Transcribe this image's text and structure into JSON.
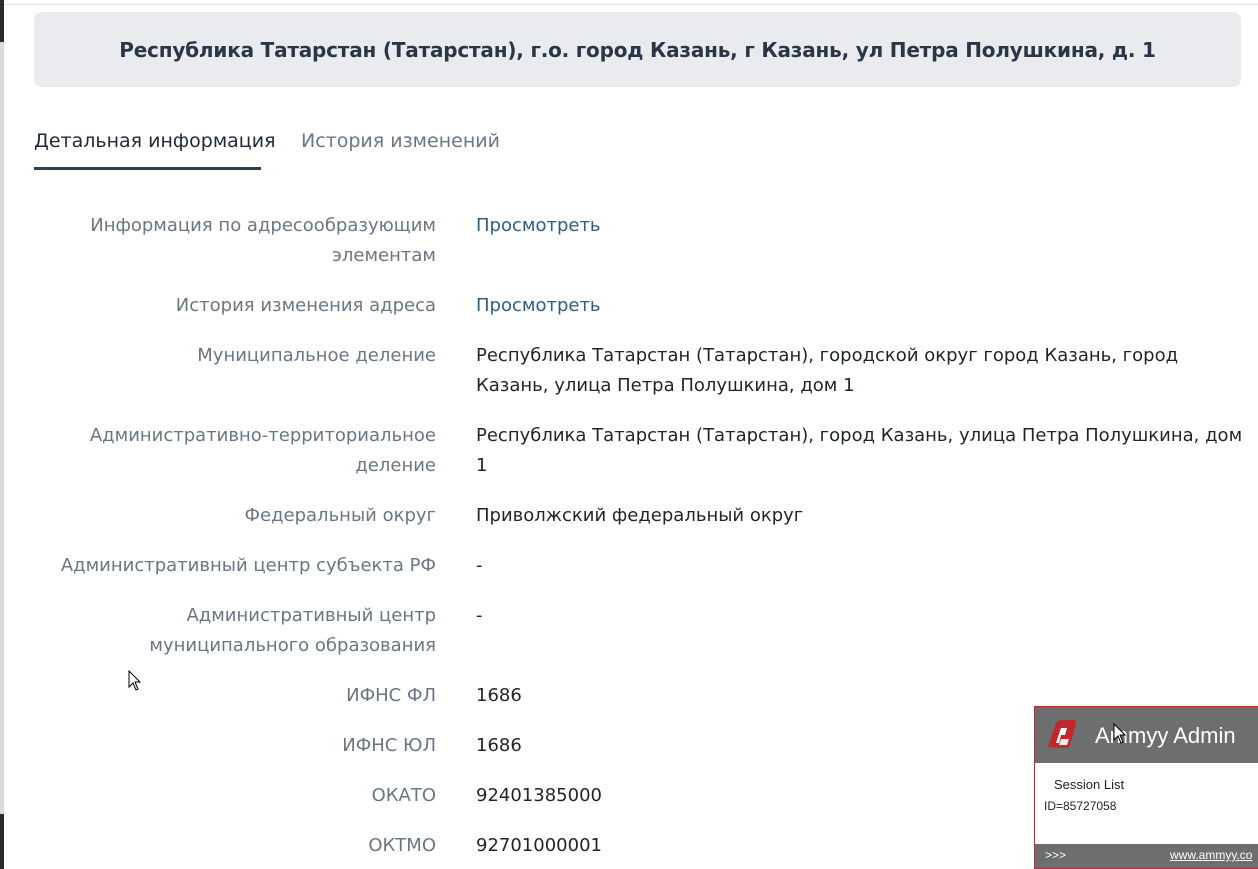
{
  "header": {
    "address_title": "Республика Татарстан (Татарстан), г.о. город Казань, г Казань, ул Петра Полушкина, д. 1"
  },
  "tabs": [
    {
      "label": "Детальная информация",
      "active": true
    },
    {
      "label": "История изменений",
      "active": false
    }
  ],
  "details": [
    {
      "label": "Информация по адресообразующим элементам",
      "value": "Просмотреть",
      "is_link": true
    },
    {
      "label": "История изменения адреса",
      "value": "Просмотреть",
      "is_link": true
    },
    {
      "label": "Муниципальное деление",
      "value": "Республика Татарстан (Татарстан), городской округ город Казань, город Казань, улица Петра Полушкина, дом 1"
    },
    {
      "label": "Административно-территориальное деление",
      "value": "Республика Татарстан (Татарстан), город Казань, улица Петра Полушкина, дом 1"
    },
    {
      "label": "Федеральный округ",
      "value": "Приволжский федеральный округ"
    },
    {
      "label": "Административный центр субъекта РФ",
      "value": "-"
    },
    {
      "label": "Административный центр муниципального образования",
      "value": "-"
    },
    {
      "label": "ИФНС ФЛ",
      "value": "1686"
    },
    {
      "label": "ИФНС ЮЛ",
      "value": "1686"
    },
    {
      "label": "ОКАТО",
      "value": "92401385000"
    },
    {
      "label": "ОКТМО",
      "value": "92701000001"
    }
  ],
  "ammyy": {
    "title": "Ammyy Admin",
    "session_list": "Session List",
    "session_id": "ID=85727058",
    "footer_arrows": ">>>",
    "footer_link": "www.ammyy.co",
    "brand_color": "#c2272d"
  }
}
